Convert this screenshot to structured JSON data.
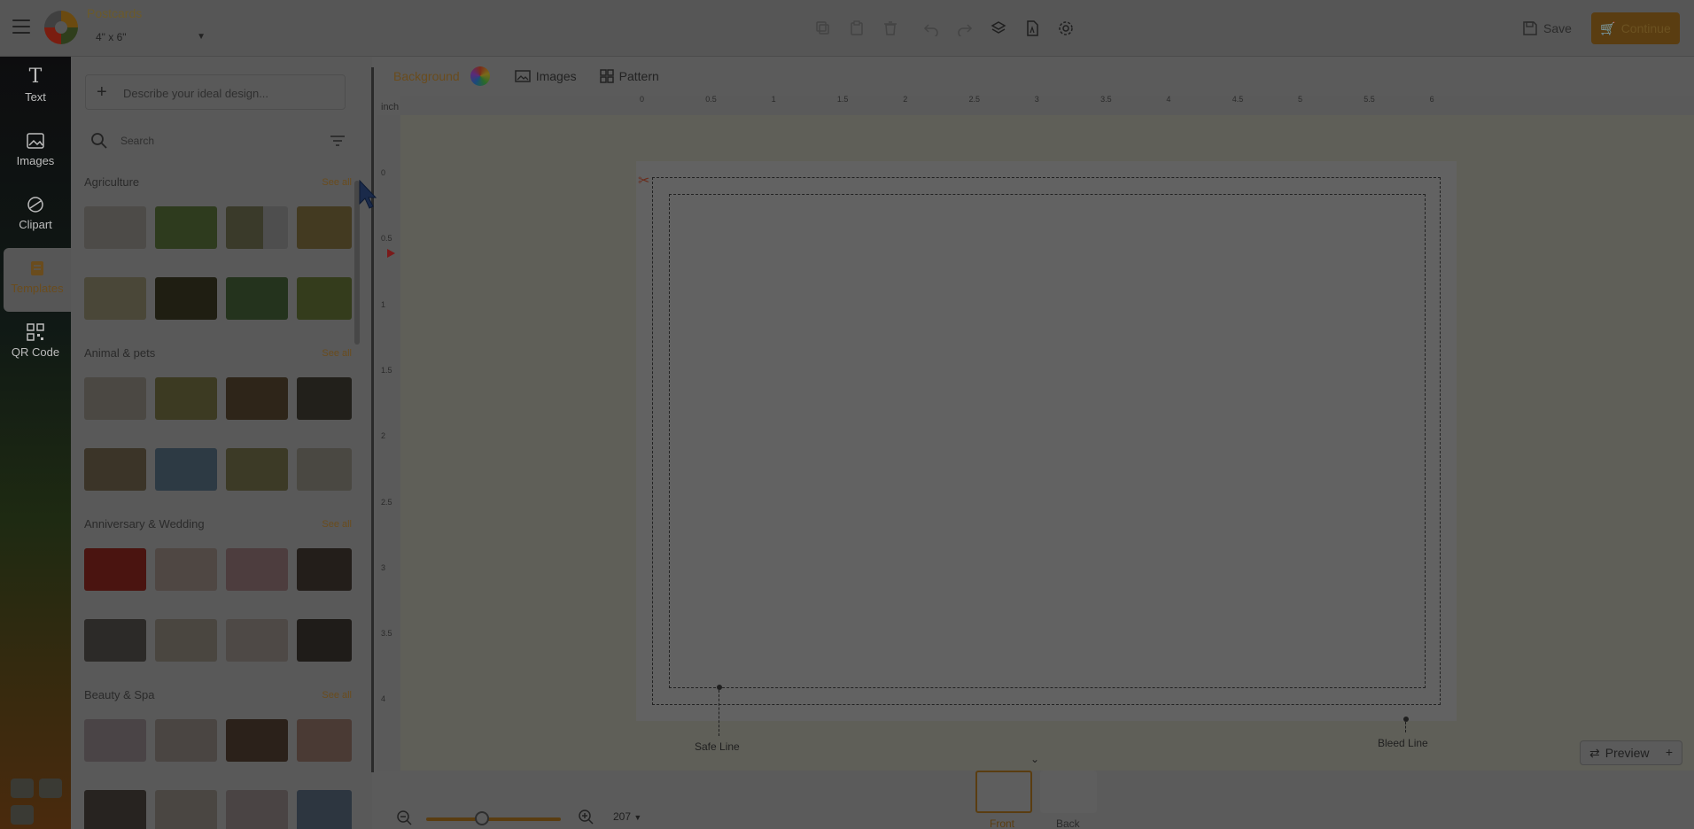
{
  "header": {
    "app_title": "Postcards",
    "size_value": "4\" x 6\"",
    "save_label": "Save",
    "continue_label": "Continue"
  },
  "rail": {
    "items": [
      {
        "label": "Text",
        "icon": "text-icon"
      },
      {
        "label": "Images",
        "icon": "image-icon"
      },
      {
        "label": "Clipart",
        "icon": "clipart-icon"
      },
      {
        "label": "Templates",
        "icon": "templates-icon"
      },
      {
        "label": "QR Code",
        "icon": "qr-code-icon"
      }
    ]
  },
  "panel": {
    "ai_placeholder": "Describe your ideal design...",
    "search_placeholder": "Search",
    "see_all_label": "See all",
    "categories": [
      {
        "title": "Agriculture"
      },
      {
        "title": "Animal & pets"
      },
      {
        "title": "Anniversary & Wedding"
      },
      {
        "title": "Beauty & Spa"
      }
    ]
  },
  "canvas_toolbar": {
    "background_label": "Background",
    "images_label": "Images",
    "pattern_label": "Pattern"
  },
  "rulers": {
    "unit": "inch",
    "horizontal": [
      "0",
      "0.5",
      "1",
      "1.5",
      "2",
      "2.5",
      "3",
      "3.5",
      "4",
      "4.5",
      "5",
      "5.5",
      "6"
    ],
    "vertical": [
      "0",
      "0.5",
      "1",
      "1.5",
      "2",
      "2.5",
      "3",
      "3.5",
      "4"
    ]
  },
  "canvas": {
    "safe_line_label": "Safe Line",
    "bleed_line_label": "Bleed Line",
    "preview_label": "Preview"
  },
  "bottom": {
    "zoom_value": "207",
    "front_label": "Front",
    "back_label": "Back"
  },
  "colors": {
    "accent": "#e8a33d",
    "overlay": "rgba(0,0,0,0.65)"
  }
}
